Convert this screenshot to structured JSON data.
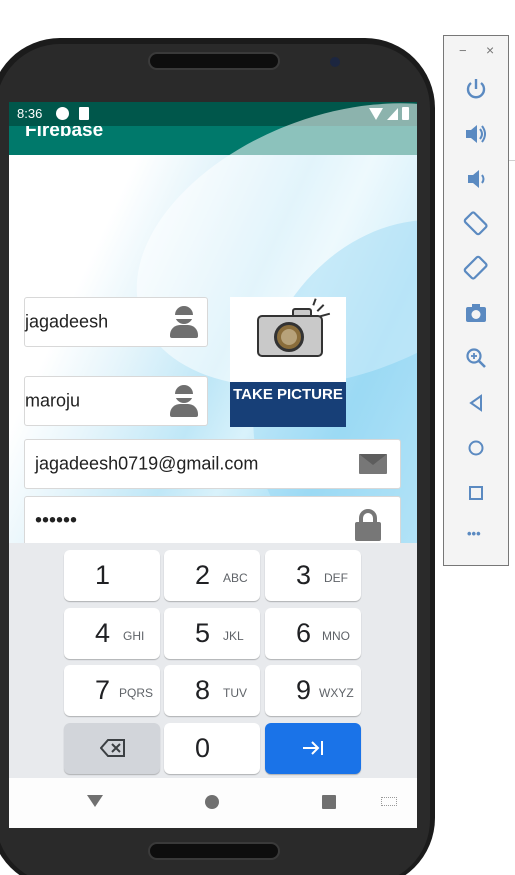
{
  "status_bar": {
    "time": "8:36"
  },
  "app_bar": {
    "title": "Firebase"
  },
  "form": {
    "first_name": "jagadeesh",
    "last_name": "maroju",
    "email": "jagadeesh0719@gmail.com",
    "password_mask": "••••••"
  },
  "take_picture": {
    "label": "TAKE PICTURE"
  },
  "keyboard": {
    "keys": [
      {
        "num": "1",
        "letters": ""
      },
      {
        "num": "2",
        "letters": "ABC"
      },
      {
        "num": "3",
        "letters": "DEF"
      },
      {
        "num": "4",
        "letters": "GHI"
      },
      {
        "num": "5",
        "letters": "JKL"
      },
      {
        "num": "6",
        "letters": "MNO"
      },
      {
        "num": "7",
        "letters": "PQRS"
      },
      {
        "num": "8",
        "letters": "TUV"
      },
      {
        "num": "9",
        "letters": "WXYZ"
      },
      {
        "num": "0",
        "letters": ""
      }
    ]
  },
  "emulator_panel": {
    "minimize": "−",
    "close": "×",
    "buttons": [
      "power-icon",
      "volume-up-icon",
      "volume-down-icon",
      "rotate-left-icon",
      "rotate-right-icon",
      "camera-icon",
      "zoom-icon",
      "back-icon",
      "home-icon",
      "overview-icon",
      "more-icon"
    ],
    "more": "•••"
  },
  "colors": {
    "status_bar": "#00574b",
    "app_bar": "#00796b",
    "action_key": "#1a73e8",
    "picture_banner": "#173f77"
  }
}
